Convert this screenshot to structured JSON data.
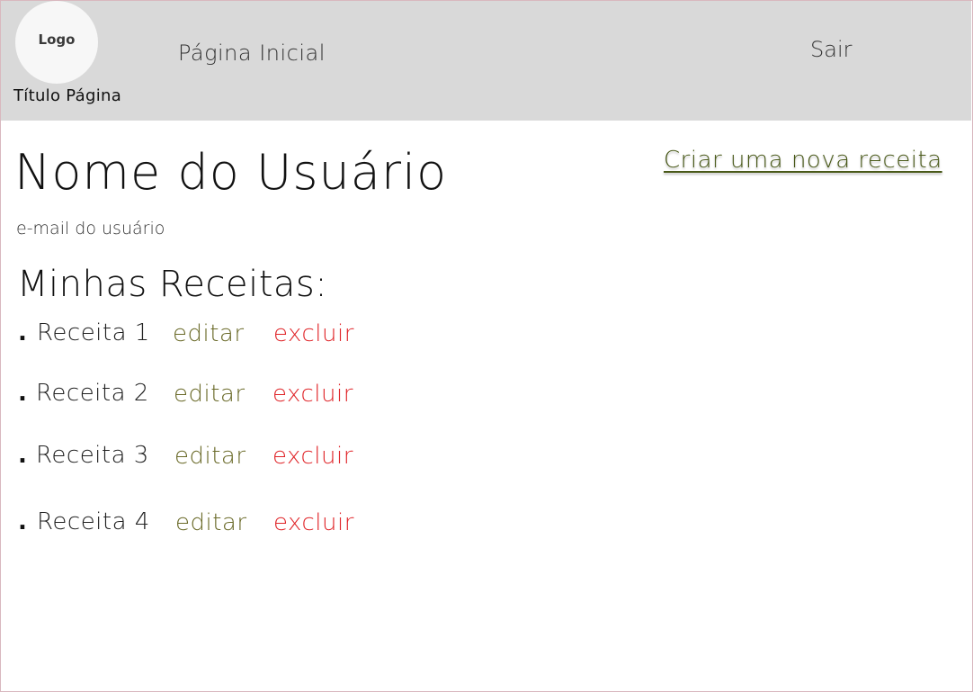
{
  "header": {
    "logo_label": "Logo",
    "page_title": "Título Página",
    "nav_home": "Página Inicial",
    "nav_logout": "Sair"
  },
  "profile": {
    "user_name": "Nome do Usuário",
    "user_email": "e-mail do usuário",
    "create_recipe_link": "Criar uma nova receita"
  },
  "recipes": {
    "title": "Minhas Receitas:",
    "bullet": ".",
    "edit_label": "editar",
    "delete_label": "excluir",
    "items": [
      {
        "name": "Receita 1"
      },
      {
        "name": "Receita 2"
      },
      {
        "name": "Receita 3"
      },
      {
        "name": "Receita 4"
      }
    ]
  },
  "colors": {
    "header_bg": "#d9d9d9",
    "edit_link": "#6b6b2a",
    "delete_link": "#e0262a",
    "create_link": "#4a5a1a"
  }
}
